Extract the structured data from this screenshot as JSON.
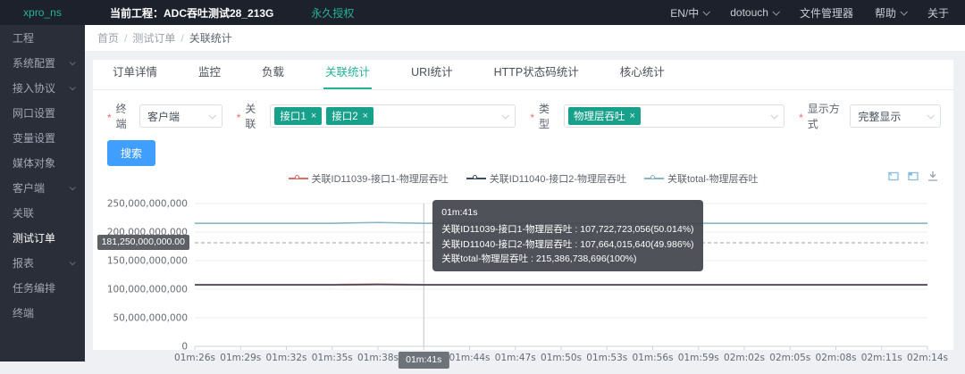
{
  "header": {
    "logo": "xpro_ns",
    "project_label": "当前工程：ADC吞吐测试28_213G",
    "license": "永久授权",
    "nav": [
      {
        "label": "EN/中",
        "dropdown": true
      },
      {
        "label": "dotouch",
        "dropdown": true
      },
      {
        "label": "文件管理器",
        "dropdown": false
      },
      {
        "label": "帮助",
        "dropdown": true
      },
      {
        "label": "关于",
        "dropdown": false
      }
    ]
  },
  "sidebar": {
    "items": [
      {
        "label": "工程",
        "chevron": false,
        "active": false
      },
      {
        "label": "系统配置",
        "chevron": true,
        "active": false
      },
      {
        "label": "接入协议",
        "chevron": true,
        "active": false
      },
      {
        "label": "网口设置",
        "chevron": false,
        "active": false
      },
      {
        "label": "变量设置",
        "chevron": false,
        "active": false
      },
      {
        "label": "媒体对象",
        "chevron": false,
        "active": false
      },
      {
        "label": "客户端",
        "chevron": true,
        "active": false
      },
      {
        "label": "关联",
        "chevron": false,
        "active": false
      },
      {
        "label": "测试订单",
        "chevron": false,
        "active": true
      },
      {
        "label": "报表",
        "chevron": true,
        "active": false
      },
      {
        "label": "任务编排",
        "chevron": false,
        "active": false
      },
      {
        "label": "终端",
        "chevron": false,
        "active": false
      }
    ]
  },
  "breadcrumb": {
    "items": [
      "首页",
      "测试订单",
      "关联统计"
    ]
  },
  "tabs": [
    {
      "label": "订单详情",
      "active": false
    },
    {
      "label": "监控",
      "active": false
    },
    {
      "label": "负载",
      "active": false
    },
    {
      "label": "关联统计",
      "active": true
    },
    {
      "label": "URI统计",
      "active": false
    },
    {
      "label": "HTTP状态码统计",
      "active": false
    },
    {
      "label": "核心统计",
      "active": false
    }
  ],
  "filters": {
    "terminal": {
      "label": "终端",
      "value": "客户端"
    },
    "relation": {
      "label": "关联",
      "tags": [
        "接口1",
        "接口2"
      ]
    },
    "type": {
      "label": "类型",
      "tags": [
        "物理层吞吐"
      ]
    },
    "display": {
      "label": "显示方式",
      "value": "完整显示"
    },
    "search_button": "搜索"
  },
  "colors": {
    "accent": "#23b39b",
    "tag": "#17a08a",
    "primary_button": "#409eff"
  },
  "toolbox": {
    "icons": [
      "data-zoom",
      "zoom-reset",
      "download"
    ]
  },
  "chart_data": {
    "type": "line",
    "x": [
      "01m:26s",
      "01m:29s",
      "01m:32s",
      "01m:35s",
      "01m:38s",
      "01m:41s",
      "01m:44s",
      "01m:47s",
      "01m:50s",
      "01m:53s",
      "01m:56s",
      "01m:59s",
      "02m:02s",
      "02m:05s",
      "02m:08s",
      "02m:11s",
      "02m:14s"
    ],
    "series": [
      {
        "name": "关联ID11039-接口1-物理层吞吐",
        "color": "#dd6b66",
        "values": [
          107700000000,
          107690000000,
          107710000000,
          107730000000,
          108450000000,
          107722723056,
          107700000000,
          107720000000,
          107690000000,
          107710000000,
          107700000000,
          107710000000,
          107700000000,
          107690000000,
          107710000000,
          107700000000,
          107710000000
        ]
      },
      {
        "name": "关联ID11040-接口2-物理层吞吐",
        "color": "#3a4f63",
        "values": [
          107650000000,
          107640000000,
          107660000000,
          107670000000,
          108350000000,
          107664015640,
          107650000000,
          107660000000,
          107640000000,
          107660000000,
          107650000000,
          107660000000,
          107650000000,
          107640000000,
          107660000000,
          107650000000,
          107660000000
        ]
      },
      {
        "name": "关联total-物理层吞吐",
        "color": "#86b6c2",
        "values": [
          215350000000,
          215330000000,
          215370000000,
          215400000000,
          216800000000,
          215386738696,
          215350000000,
          215380000000,
          215330000000,
          215370000000,
          215350000000,
          215370000000,
          215350000000,
          215330000000,
          215370000000,
          215350000000,
          215370000000
        ]
      }
    ],
    "ylim": [
      0,
      250000000000
    ],
    "yticks": [
      0,
      50000000000,
      100000000000,
      150000000000,
      200000000000,
      250000000000
    ],
    "ytick_labels": [
      "0",
      "50,000,000,000",
      "100,000,000,000",
      "150,000,000,000",
      "200,000,000,000",
      "250,000,000,000"
    ],
    "grid": true,
    "legend_position": "top",
    "marked_y": {
      "value": 181250000000,
      "label": "181,250,000,000.00"
    },
    "highlighted_x": "01m:41s",
    "tooltip": {
      "title": "01m:41s",
      "rows": [
        "关联ID11039-接口1-物理层吞吐 : 107,722,723,056(50.014%)",
        "关联ID11040-接口2-物理层吞吐 : 107,664,015,640(49.986%)",
        "关联total-物理层吞吐 : 215,386,738,696(100%)"
      ]
    }
  }
}
